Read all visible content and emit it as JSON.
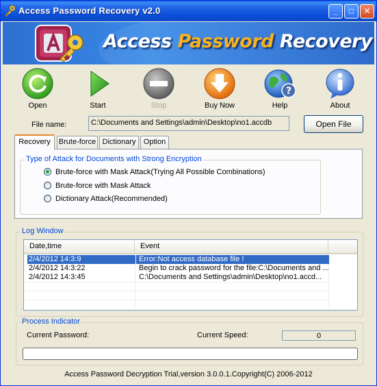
{
  "window": {
    "title": "Access Password Recovery v2.0"
  },
  "banner": {
    "title_part1": "Access",
    "title_part2": "Password",
    "title_part3": "Recovery"
  },
  "toolbar": {
    "open": "Open",
    "start": "Start",
    "stop": "Stop",
    "buy_now": "Buy Now",
    "help": "Help",
    "about": "About"
  },
  "file": {
    "label": "File name:",
    "value": "C:\\Documents and Settings\\admin\\Desktop\\no1.accdb",
    "open_button": "Open File"
  },
  "tabs": [
    "Recovery",
    "Brute-force",
    "Dictionary",
    "Option"
  ],
  "attack": {
    "group_title": "Type of Attack for Documents with Strong Encryption",
    "options": [
      {
        "label": "Brute-force with Mask Attack(Trying All Possible Combinations)",
        "checked": true
      },
      {
        "label": "Brute-force with Mask Attack",
        "checked": false
      },
      {
        "label": "Dictionary Attack(Recommended)",
        "checked": false
      }
    ]
  },
  "log": {
    "group_title": "Log Window",
    "columns": [
      "Date,time",
      "Event"
    ],
    "rows": [
      {
        "datetime": "2/4/2012 14:3:9",
        "event": "Error:Not access database file !"
      },
      {
        "datetime": "2/4/2012 14:3:22",
        "event": "Begin to crack password for the file:C:\\Documents and ..."
      },
      {
        "datetime": "2/4/2012 14:3:45",
        "event": "C:\\Documents and Settings\\admin\\Desktop\\no1.accd..."
      }
    ]
  },
  "process": {
    "group_title": "Process Indicator",
    "current_password_label": "Current Password:",
    "current_speed_label": "Current Speed:",
    "current_speed_value": "0",
    "progress_fraction": 0
  },
  "status": {
    "text": "Access Password Decryption Trial,version 3.0.0.1.Copyright(C) 2006-2012"
  },
  "colors": {
    "titlebar": "#0a4fd8",
    "banner": "#2d6fd0",
    "accent_orange": "#f7b11e",
    "selection": "#316ac5",
    "groupbox_title": "#0046d5"
  }
}
